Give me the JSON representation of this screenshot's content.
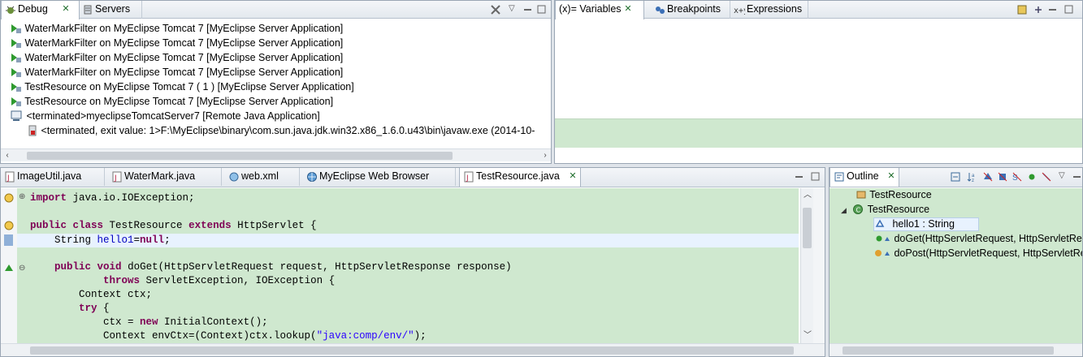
{
  "colors": {
    "editor_background": "#cfe8cf",
    "current_line": "#e8f2fe",
    "keyword": "#7f0055",
    "field": "#0000c0",
    "string": "#2a00ff"
  },
  "debug_view": {
    "tabs": [
      {
        "label": "Debug",
        "icon": "debug-icon",
        "active": true
      },
      {
        "label": "Servers",
        "icon": "servers-icon",
        "active": false
      }
    ],
    "items": [
      "WaterMarkFilter on MyEclipse Tomcat 7 [MyEclipse Server Application]",
      "WaterMarkFilter on MyEclipse Tomcat 7 [MyEclipse Server Application]",
      "WaterMarkFilter on MyEclipse Tomcat 7 [MyEclipse Server Application]",
      "WaterMarkFilter on MyEclipse Tomcat 7 [MyEclipse Server Application]",
      "TestResource on MyEclipse Tomcat 7 ( 1 )  [MyEclipse Server Application]",
      "TestResource on MyEclipse Tomcat 7 [MyEclipse Server Application]",
      "<terminated>myeclipseTomcatServer7 [Remote Java Application]",
      "<terminated, exit value: 1>F:\\MyEclipse\\binary\\com.sun.java.jdk.win32.x86_1.6.0.u43\\bin\\javaw.exe (2014-10-"
    ]
  },
  "variables_view": {
    "tabs": [
      {
        "label": "(x)= Variables",
        "active": true
      },
      {
        "label": "Breakpoints",
        "active": false
      },
      {
        "label": "Expressions",
        "active": false
      }
    ]
  },
  "editor": {
    "tabs": [
      {
        "label": "ImageUtil.java",
        "active": false
      },
      {
        "label": "WaterMark.java",
        "active": false
      },
      {
        "label": "web.xml",
        "active": false
      },
      {
        "label": "MyEclipse Web Browser",
        "active": false
      },
      {
        "label": "TestResource.java",
        "active": true
      }
    ],
    "lines": [
      {
        "text": "import java.io.IOException;",
        "indent": 0
      },
      {
        "text": "",
        "indent": 0
      },
      {
        "text": "public class TestResource extends HttpServlet {",
        "indent": 0
      },
      {
        "text": "    String hello1=null;",
        "indent": 0
      },
      {
        "text": "",
        "indent": 0
      },
      {
        "text": "    public void doGet(HttpServletRequest request, HttpServletResponse response)",
        "indent": 0
      },
      {
        "text": "            throws ServletException, IOException {",
        "indent": 0
      },
      {
        "text": "        Context ctx;",
        "indent": 0
      },
      {
        "text": "        try {",
        "indent": 0
      },
      {
        "text": "            ctx = new InitialContext();",
        "indent": 0
      },
      {
        "text": "            Context envCtx=(Context)ctx.lookup(\"java:comp/env/\");",
        "indent": 0
      }
    ]
  },
  "outline_view": {
    "tab": {
      "label": "Outline",
      "active": true
    },
    "items": [
      {
        "label": "TestResource",
        "level": 0
      },
      {
        "label": "TestResource",
        "level": 0
      },
      {
        "label": "hello1 : String",
        "level": 1
      },
      {
        "label": "doGet(HttpServletRequest, HttpServletRe",
        "level": 1
      },
      {
        "label": "doPost(HttpServletRequest, HttpServletRe",
        "level": 1
      }
    ]
  }
}
